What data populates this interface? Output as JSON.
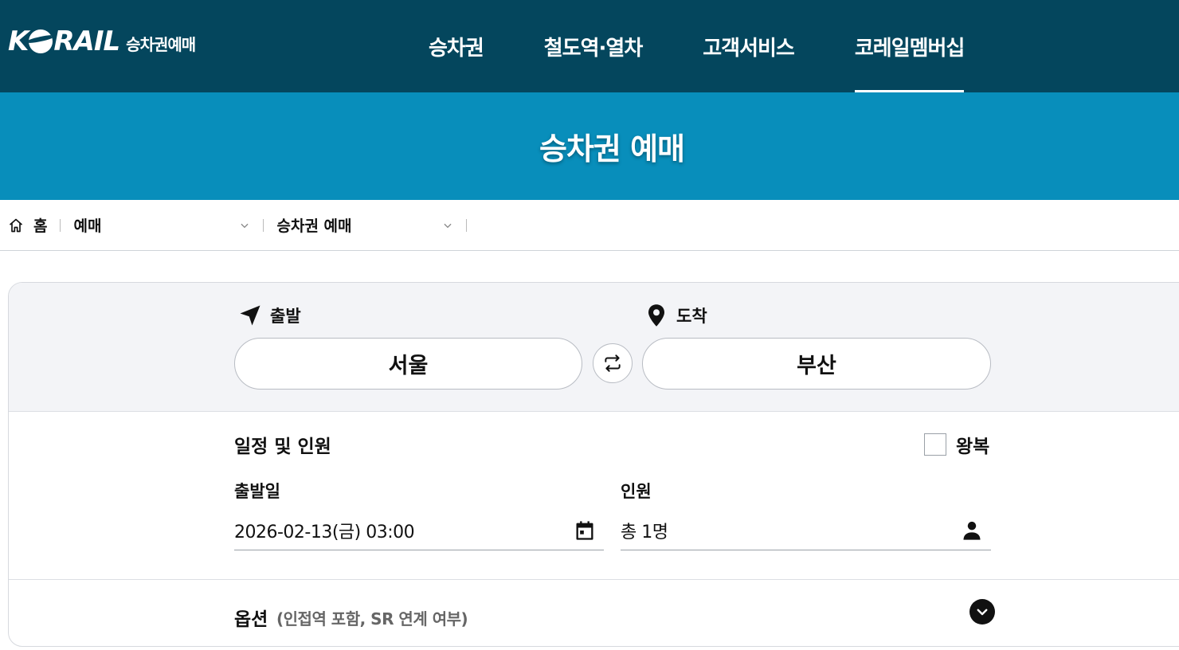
{
  "header": {
    "logo_text": "KORAIL",
    "logo_sub": "승차권예매",
    "nav": [
      {
        "label": "승차권"
      },
      {
        "label": "철도역·열차"
      },
      {
        "label": "고객서비스"
      },
      {
        "label": "코레일멤버십"
      }
    ],
    "active_nav": "코레일멤버십"
  },
  "banner": {
    "title": "승차권 예매"
  },
  "breadcrumb": {
    "home": "홈",
    "level1": "예매",
    "level2": "승차권 예매"
  },
  "route": {
    "departure_label": "출발",
    "arrival_label": "도착",
    "departure_station": "서울",
    "arrival_station": "부산"
  },
  "schedule": {
    "title": "일정 및 인원",
    "roundtrip_label": "왕복",
    "roundtrip_checked": false,
    "date_label": "출발일",
    "date_value": "2026-02-13(금) 03:00",
    "passenger_label": "인원",
    "passenger_value": "총 1명"
  },
  "options": {
    "title": "옵션",
    "subtitle": "(인접역 포함, SR 연계 여부)"
  },
  "colors": {
    "header_bg": "#04465d",
    "banner_bg": "#088ebb",
    "route_bg": "#f3f4f7"
  }
}
